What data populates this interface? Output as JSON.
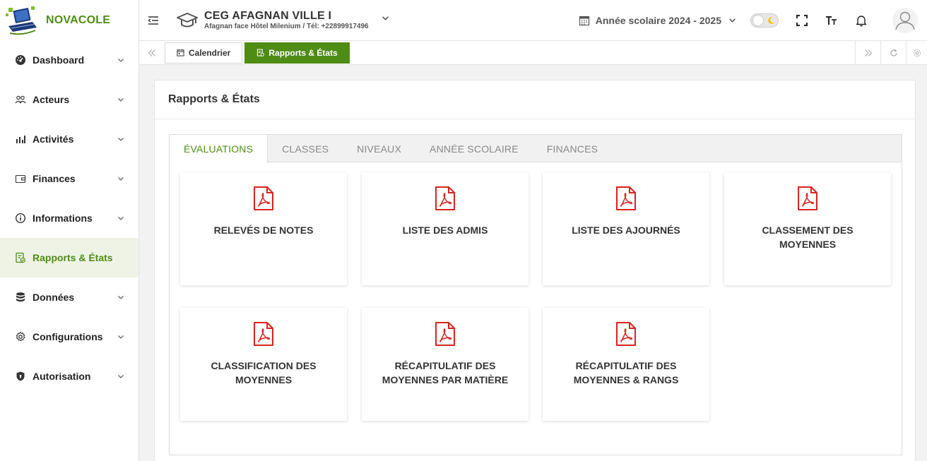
{
  "brand": {
    "name": "NOVACOLE"
  },
  "sidebar": {
    "items": [
      {
        "label": "Dashboard",
        "icon": "gauge-icon"
      },
      {
        "label": "Acteurs",
        "icon": "users-icon"
      },
      {
        "label": "Activités",
        "icon": "bar-chart-icon"
      },
      {
        "label": "Finances",
        "icon": "wallet-icon"
      },
      {
        "label": "Informations",
        "icon": "info-icon"
      },
      {
        "label": "Rapports & États",
        "icon": "report-icon",
        "active": true
      },
      {
        "label": "Données",
        "icon": "database-icon"
      },
      {
        "label": "Configurations",
        "icon": "gear-icon"
      },
      {
        "label": "Autorisation",
        "icon": "shield-icon"
      }
    ]
  },
  "header": {
    "school_name": "CEG AFAGNAN VILLE I",
    "school_sub": "Afagnan face Hôtel Milenium / Tél: +22899917496",
    "year_label": "Année scolaire 2024 - 2025"
  },
  "tabbar": {
    "tabs": [
      {
        "label": "Calendrier"
      },
      {
        "label": "Rapports & États",
        "active": true
      }
    ]
  },
  "panel": {
    "title": "Rapports & États",
    "tabs": [
      {
        "label": "ÉVALUATIONS",
        "active": true
      },
      {
        "label": "CLASSES"
      },
      {
        "label": "NIVEAUX"
      },
      {
        "label": "ANNÉE SCOLAIRE"
      },
      {
        "label": "FINANCES"
      }
    ],
    "cards": [
      {
        "label": "RELEVÉS DE NOTES"
      },
      {
        "label": "LISTE DES ADMIS"
      },
      {
        "label": "LISTE DES AJOURNÉS"
      },
      {
        "label": "CLASSEMENT DES MOYENNES"
      },
      {
        "label": "CLASSIFICATION DES MOYENNES"
      },
      {
        "label": "RÉCAPITULATIF DES MOYENNES PAR MATIÈRE"
      },
      {
        "label": "RÉCAPITULATIF DES MOYENNES & RANGS"
      }
    ]
  },
  "colors": {
    "accent": "#4e8c14",
    "pdf": "#d9241c"
  }
}
